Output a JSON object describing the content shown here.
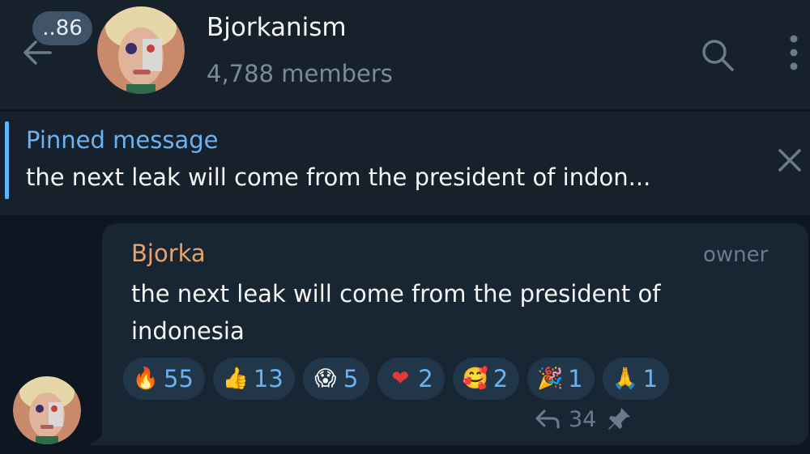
{
  "header": {
    "unread_badge": "..86",
    "title": "Bjorkanism",
    "members": "4,788 members",
    "back_icon": "back-arrow-icon",
    "search_icon": "search-icon",
    "more_icon": "more-vertical-icon"
  },
  "pinned": {
    "label": "Pinned message",
    "text": "the next leak will come from the president of indon...",
    "close_icon": "close-icon"
  },
  "message": {
    "sender": "Bjorka",
    "role": "owner",
    "text": "the next leak will come from the president of indonesia",
    "reactions": [
      {
        "emoji": "🔥",
        "count": "55"
      },
      {
        "emoji": "👍",
        "count": "13"
      },
      {
        "emoji": "😱",
        "count": "5"
      },
      {
        "emoji": "❤",
        "count": "2"
      },
      {
        "emoji": "🥰",
        "count": "2"
      },
      {
        "emoji": "🎉",
        "count": "1"
      },
      {
        "emoji": "🙏",
        "count": "1"
      }
    ],
    "forwards": "34",
    "forward_icon": "reply-arrow-icon",
    "pin_icon": "pin-icon"
  },
  "colors": {
    "header_bg": "#17212b",
    "chat_bg": "#0e1621",
    "bubble_bg": "#182533",
    "accent": "#6ab3f3",
    "sender": "#e6a36b"
  }
}
